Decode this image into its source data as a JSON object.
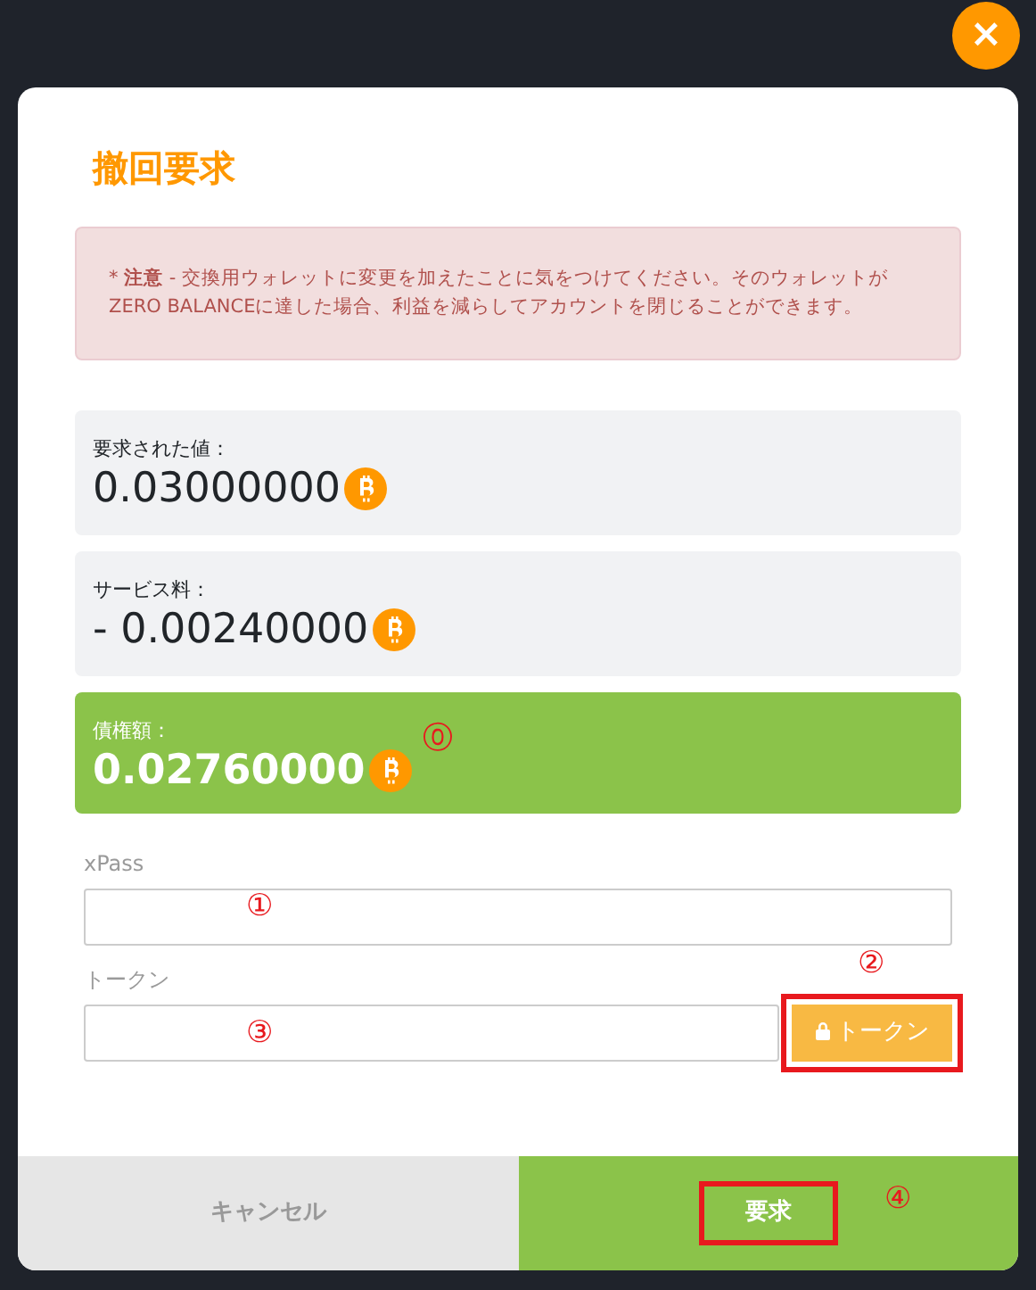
{
  "close_button": {
    "label": "×"
  },
  "title": "撤回要求",
  "alert": {
    "text": "* **注意** - 交換用ウォレットに変更を加えたことに気をつけてください。そのウォレットがZERO BALANCEに達した場合、利益を減らしてアカウントを閉じることができます。"
  },
  "amounts": [
    {
      "label": "要求された値：",
      "value": "0.03000000",
      "kind": "plain"
    },
    {
      "label": "サービス料：",
      "value": "- 0.00240000",
      "kind": "plain"
    },
    {
      "label": "債権額：",
      "value": "0.02760000",
      "kind": "total"
    }
  ],
  "fields": [
    {
      "label": "xPass",
      "kind": "text"
    },
    {
      "label": "トークン",
      "kind": "token",
      "button": "トークン",
      "highlighted": true
    }
  ],
  "footer": [
    {
      "label": "キャンセル",
      "kind": "cancel",
      "highlighted": false
    },
    {
      "label": "要求",
      "kind": "submit",
      "highlighted": true
    }
  ],
  "callouts": [
    "⓪",
    "①",
    "②",
    "③",
    "④"
  ]
}
